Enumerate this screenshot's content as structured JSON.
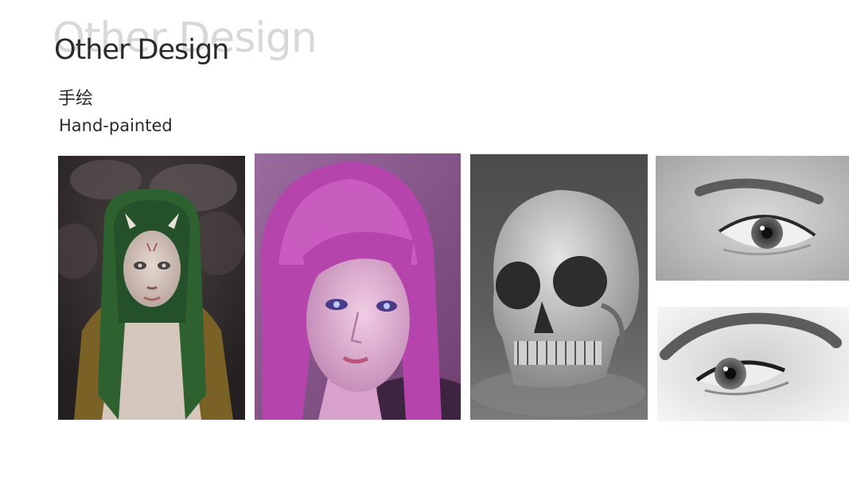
{
  "header": {
    "ghost_title": "Other Design",
    "title": "Other Design",
    "subtitle_cn": "手绘",
    "subtitle_en": "Hand-painted"
  },
  "gallery": [
    {
      "subject": "girl-with-horns-portrait",
      "palette": [
        "#2e2828",
        "#2e5a2c",
        "#d9c8bc"
      ]
    },
    {
      "subject": "pink-hair-girl-portrait",
      "palette": [
        "#7a3a78",
        "#c15cb8",
        "#e8b9d8"
      ]
    },
    {
      "subject": "skull-study",
      "palette": [
        "#3a3a3a",
        "#7c7c7c",
        "#cfcfcf"
      ]
    },
    {
      "subject": "eye-study-open",
      "palette": [
        "#c8c8c8",
        "#6a6a6a",
        "#2c2c2c"
      ]
    },
    {
      "subject": "eye-study-side",
      "palette": [
        "#f2f2f2",
        "#8a8a8a",
        "#2a2a2a"
      ]
    }
  ]
}
